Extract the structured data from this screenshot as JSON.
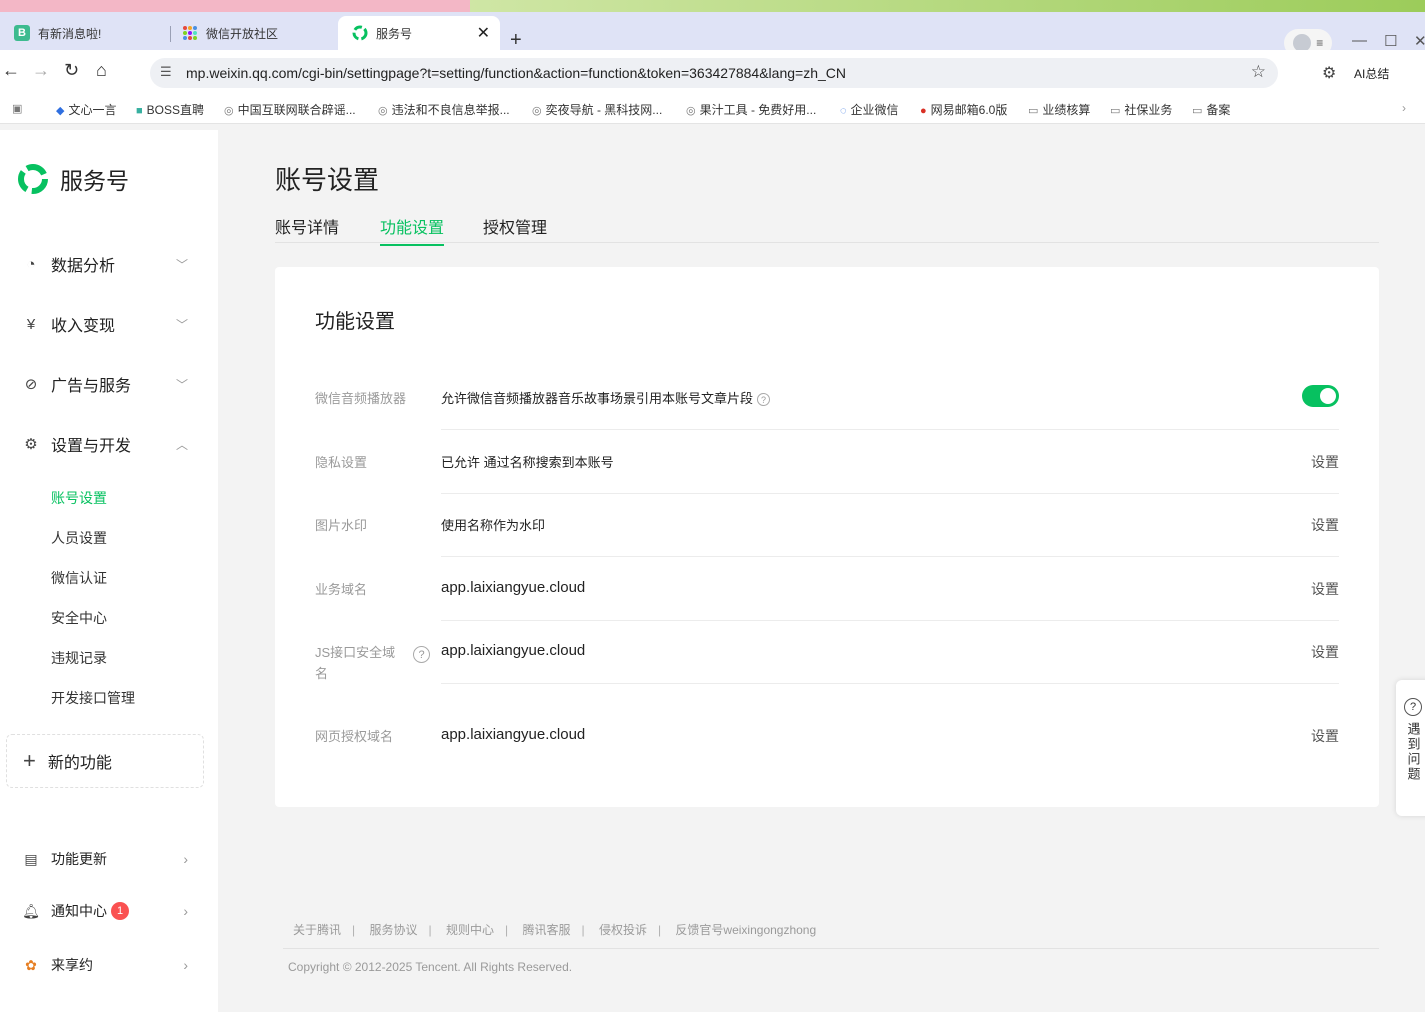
{
  "browser": {
    "tabs": [
      {
        "title": "有新消息啦!",
        "icon": "B"
      },
      {
        "title": "微信开放社区",
        "icon": "grid-icon"
      },
      {
        "title": "服务号",
        "icon": "service-logo-icon"
      }
    ],
    "url": "mp.weixin.qq.com/cgi-bin/settingpage?t=setting/function&action=function&token=363427884&lang=zh_CN",
    "ai_label": "AI总结",
    "bookmarks": [
      "文心一言",
      "BOSS直聘",
      "中国互联网联合辟谣...",
      "违法和不良信息举报...",
      "奕夜导航 - 黑科技网...",
      "果汁工具 - 免费好用...",
      "企业微信",
      "网易邮箱6.0版",
      "业绩核算",
      "社保业务",
      "备案"
    ]
  },
  "sidebar": {
    "logo_text": "服务号",
    "nav": [
      {
        "label": "数据分析"
      },
      {
        "label": "收入变现"
      },
      {
        "label": "广告与服务"
      },
      {
        "label": "设置与开发"
      }
    ],
    "sub_items": [
      "账号设置",
      "人员设置",
      "微信认证",
      "安全中心",
      "违规记录",
      "开发接口管理"
    ],
    "new_feature": "新的功能",
    "footer": [
      {
        "label": "功能更新"
      },
      {
        "label": "通知中心",
        "badge": "1"
      },
      {
        "label": "来享约"
      }
    ]
  },
  "main": {
    "title": "账号设置",
    "tabs": [
      "账号详情",
      "功能设置",
      "授权管理"
    ],
    "card": {
      "title": "功能设置",
      "rows": [
        {
          "label": "微信音频播放器",
          "value": "允许微信音频播放器音乐故事场景引用本账号文章片段",
          "toggle_on": true
        },
        {
          "label": "隐私设置",
          "value": "已允许 通过名称搜索到本账号",
          "action": "设置"
        },
        {
          "label": "图片水印",
          "value": "使用名称作为水印",
          "action": "设置"
        },
        {
          "label": "业务域名",
          "value": "app.laixiangyue.cloud",
          "action": "设置"
        },
        {
          "label": "JS接口安全域名",
          "value": "app.laixiangyue.cloud",
          "action": "设置"
        },
        {
          "label": "网页授权域名",
          "value": "app.laixiangyue.cloud",
          "action": "设置"
        }
      ]
    },
    "footer_links": [
      "关于腾讯",
      "服务协议",
      "规则中心",
      "腾讯客服",
      "侵权投诉",
      "反馈官号weixingongzhong"
    ],
    "copyright": "Copyright © 2012-2025 Tencent. All Rights Reserved."
  },
  "help_float": "遇到问题",
  "colors": {
    "accent": "#07c160",
    "badge": "#fa5151"
  }
}
